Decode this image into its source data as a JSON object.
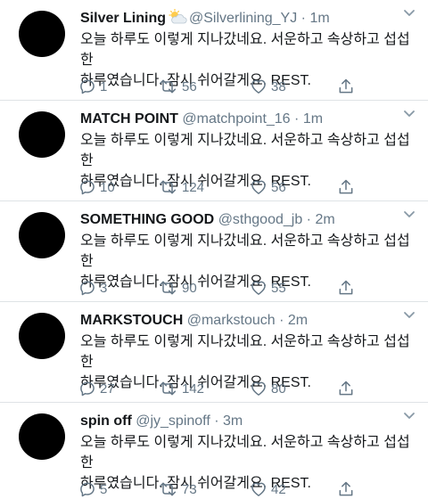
{
  "tweets": [
    {
      "name": "Silver Lining",
      "emoji": "sun-behind-cloud-icon",
      "handle": "@Silverlining_YJ",
      "sep": "·",
      "time": "1m",
      "text_line1": "오늘 하루도 이렇게 지나갔네요. 서운하고 속상하고 섭섭한",
      "text_line2": "하루였습니다. 잠시 쉬어갈게요. REST.",
      "replies": "1",
      "retweets": "56",
      "likes": "38"
    },
    {
      "name": "MATCH POINT",
      "handle": "@matchpoint_16",
      "sep": "·",
      "time": "1m",
      "text_line1": "오늘 하루도 이렇게 지나갔네요. 서운하고 속상하고 섭섭한",
      "text_line2": "하루였습니다. 잠시 쉬어갈게요. REST.",
      "replies": "10",
      "retweets": "124",
      "likes": "56"
    },
    {
      "name": "SOMETHING GOOD",
      "handle": "@sthgood_jb",
      "sep": "·",
      "time": "2m",
      "text_line1": "오늘 하루도 이렇게 지나갔네요. 서운하고 속상하고 섭섭한",
      "text_line2": "하루였습니다. 잠시 쉬어갈게요. REST.",
      "replies": "3",
      "retweets": "90",
      "likes": "55"
    },
    {
      "name": "MARKSTOUCH",
      "handle": "@markstouch",
      "sep": "·",
      "time": "2m",
      "text_line1": "오늘 하루도 이렇게 지나갔네요. 서운하고 속상하고 섭섭한",
      "text_line2": "하루였습니다. 잠시 쉬어갈게요. REST.",
      "replies": "27",
      "retweets": "142",
      "likes": "80"
    },
    {
      "name": "spin off",
      "handle": "@jy_spinoff",
      "sep": "·",
      "time": "3m",
      "text_line1": "오늘 하루도 이렇게 지나갔네요. 서운하고 속상하고 섭섭한",
      "text_line2": "하루였습니다. 잠시 쉬어갈게요. REST.",
      "replies": "5",
      "retweets": "73",
      "likes": "42"
    }
  ],
  "colors": {
    "text": "#14171a",
    "muted": "#657786",
    "divider": "#dfe3e6",
    "avatar": "#000000"
  }
}
